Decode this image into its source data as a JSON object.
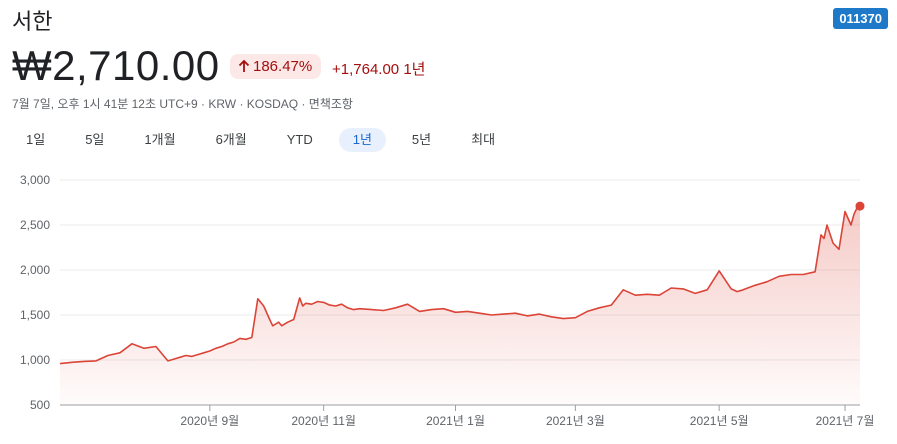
{
  "header": {
    "title": "서한",
    "ticker": "011370",
    "price": "₩2,710.00",
    "change_pct": "186.47%",
    "change_abs": "+1,764.00 1년",
    "meta": "7월 7일, 오후 1시 41분 12초 UTC+9 · KRW · KOSDAQ · 면책조항",
    "up_arrow_icon": "arrow-up-icon"
  },
  "tabs": [
    {
      "label": "1일"
    },
    {
      "label": "5일"
    },
    {
      "label": "1개월"
    },
    {
      "label": "6개월"
    },
    {
      "label": "YTD"
    },
    {
      "label": "1년",
      "active": true
    },
    {
      "label": "5년"
    },
    {
      "label": "최대"
    }
  ],
  "colors": {
    "line": "#db4437",
    "fill": "#fce8e6",
    "positive": "#a50e0e",
    "ticker_bg": "#1e7ac8",
    "active_tab_bg": "#e8f0fe",
    "active_tab_text": "#1967d2"
  },
  "chart_data": {
    "type": "area",
    "ylim": [
      500,
      3000
    ],
    "yticks": [
      "3,000",
      "2,500",
      "2,000",
      "1,500",
      "1,000",
      "500"
    ],
    "xticks": [
      {
        "label": "2020년 9월",
        "x": 0.25
      },
      {
        "label": "2020년 11월",
        "x": 0.44
      },
      {
        "label": "2021년 1월",
        "x": 0.66
      },
      {
        "label": "2021년 3월",
        "x": 0.86
      },
      {
        "label": "2021년 5월",
        "x": 1.1
      },
      {
        "label": "2021년 7월",
        "x": 1.31
      }
    ],
    "grid": true,
    "x": [
      0.0,
      0.02,
      0.04,
      0.06,
      0.08,
      0.1,
      0.12,
      0.14,
      0.16,
      0.17,
      0.18,
      0.19,
      0.2,
      0.21,
      0.22,
      0.23,
      0.24,
      0.25,
      0.26,
      0.27,
      0.28,
      0.29,
      0.3,
      0.31,
      0.32,
      0.33,
      0.34,
      0.35,
      0.355,
      0.36,
      0.365,
      0.37,
      0.38,
      0.39,
      0.4,
      0.405,
      0.41,
      0.42,
      0.43,
      0.44,
      0.45,
      0.46,
      0.47,
      0.48,
      0.49,
      0.5,
      0.52,
      0.54,
      0.56,
      0.58,
      0.6,
      0.62,
      0.64,
      0.66,
      0.68,
      0.7,
      0.72,
      0.74,
      0.76,
      0.78,
      0.8,
      0.82,
      0.84,
      0.86,
      0.88,
      0.9,
      0.92,
      0.94,
      0.96,
      0.98,
      1.0,
      1.02,
      1.04,
      1.06,
      1.08,
      1.1,
      1.12,
      1.13,
      1.14,
      1.16,
      1.18,
      1.2,
      1.22,
      1.24,
      1.26,
      1.27,
      1.275,
      1.28,
      1.29,
      1.3,
      1.31,
      1.32,
      1.325,
      1.33,
      1.335
    ],
    "values": [
      960,
      975,
      985,
      990,
      1050,
      1080,
      1180,
      1130,
      1150,
      1070,
      990,
      1010,
      1030,
      1050,
      1040,
      1060,
      1080,
      1100,
      1130,
      1150,
      1180,
      1200,
      1240,
      1230,
      1250,
      1680,
      1600,
      1450,
      1380,
      1400,
      1420,
      1380,
      1420,
      1450,
      1690,
      1600,
      1630,
      1620,
      1650,
      1640,
      1610,
      1600,
      1620,
      1580,
      1560,
      1570,
      1560,
      1550,
      1580,
      1620,
      1540,
      1560,
      1570,
      1530,
      1540,
      1520,
      1500,
      1510,
      1520,
      1490,
      1510,
      1480,
      1460,
      1470,
      1540,
      1580,
      1610,
      1780,
      1720,
      1730,
      1720,
      1800,
      1790,
      1740,
      1780,
      1990,
      1790,
      1760,
      1780,
      1830,
      1870,
      1930,
      1950,
      1950,
      1980,
      2390,
      2350,
      2500,
      2300,
      2230,
      2650,
      2500,
      2620,
      2690,
      2710
    ]
  }
}
